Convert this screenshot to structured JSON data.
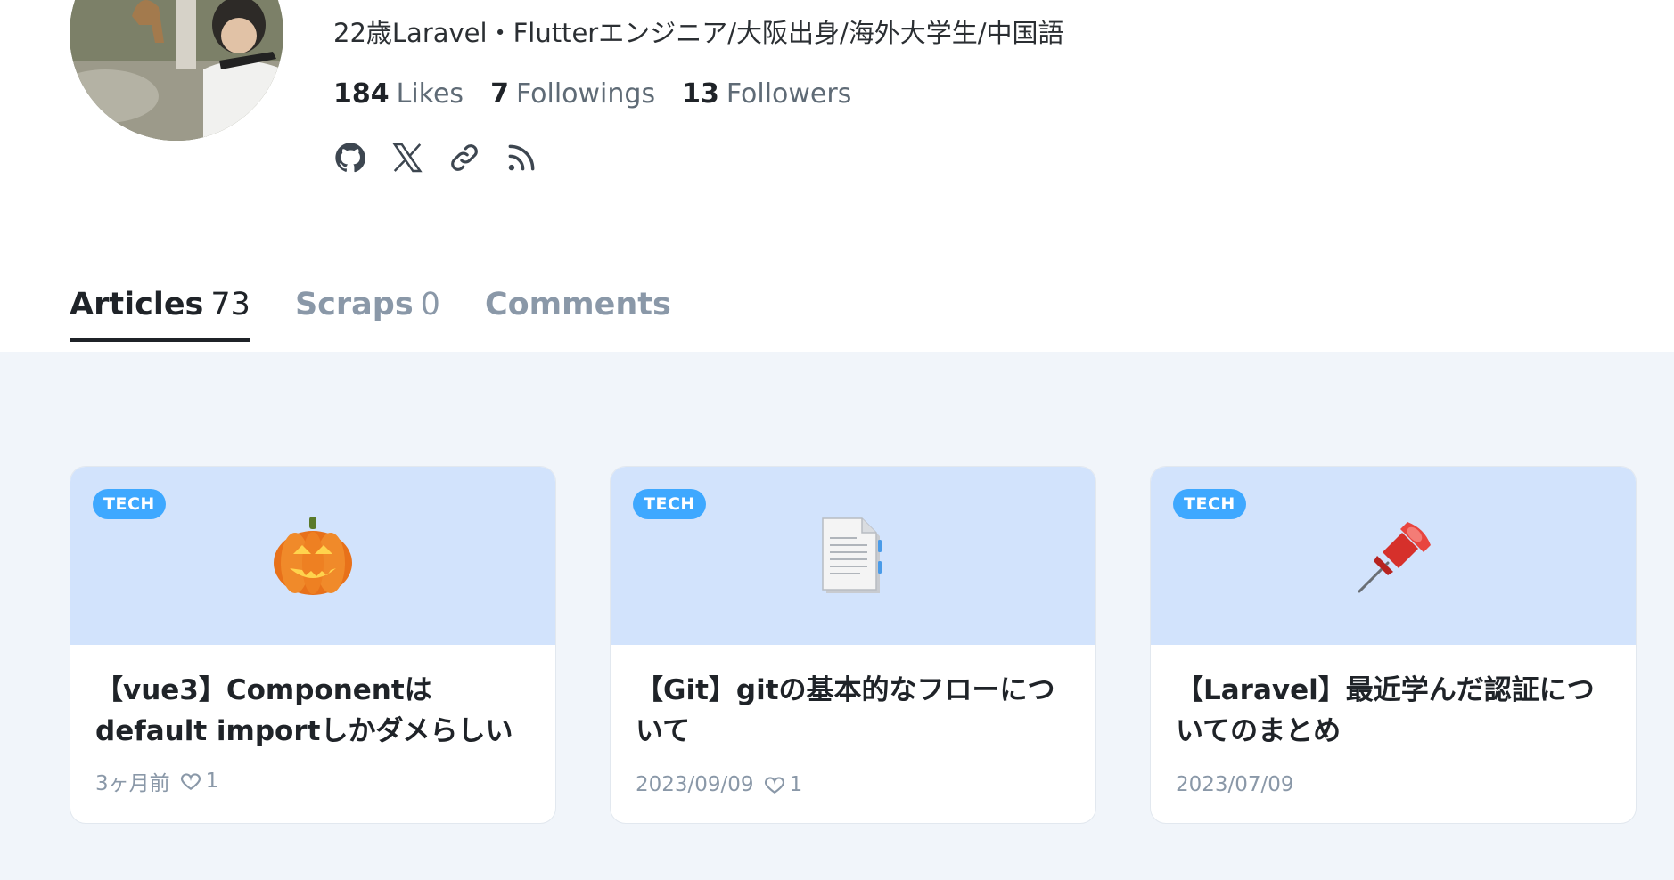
{
  "profile": {
    "bio": "22歳Laravel・Flutterエンジニア/大阪出身/海外大学生/中国語",
    "stats": [
      {
        "num": "184",
        "label": "Likes"
      },
      {
        "num": "7",
        "label": "Followings"
      },
      {
        "num": "13",
        "label": "Followers"
      }
    ],
    "socials": [
      "github-icon",
      "x-icon",
      "link-icon",
      "rss-icon"
    ]
  },
  "tabs": [
    {
      "label": "Articles",
      "count": "73",
      "active": true
    },
    {
      "label": "Scraps",
      "count": "0",
      "active": false
    },
    {
      "label": "Comments",
      "count": "",
      "active": false
    }
  ],
  "articles": [
    {
      "badge": "TECH",
      "emoji": "jack-o-lantern",
      "title": "【vue3】Componentはdefault importしかダメらしい",
      "date": "3ヶ月前",
      "likes": "1"
    },
    {
      "badge": "TECH",
      "emoji": "page-facing-up",
      "title": "【Git】gitの基本的なフローについて",
      "date": "2023/09/09",
      "likes": "1"
    },
    {
      "badge": "TECH",
      "emoji": "pushpin",
      "title": "【Laravel】最近学んだ認証についてのまとめ",
      "date": "2023/07/09",
      "likes": ""
    }
  ],
  "colors": {
    "accent": "#3ea8ff",
    "card_top": "#d2e3fc",
    "list_bg": "#f1f5fa"
  }
}
